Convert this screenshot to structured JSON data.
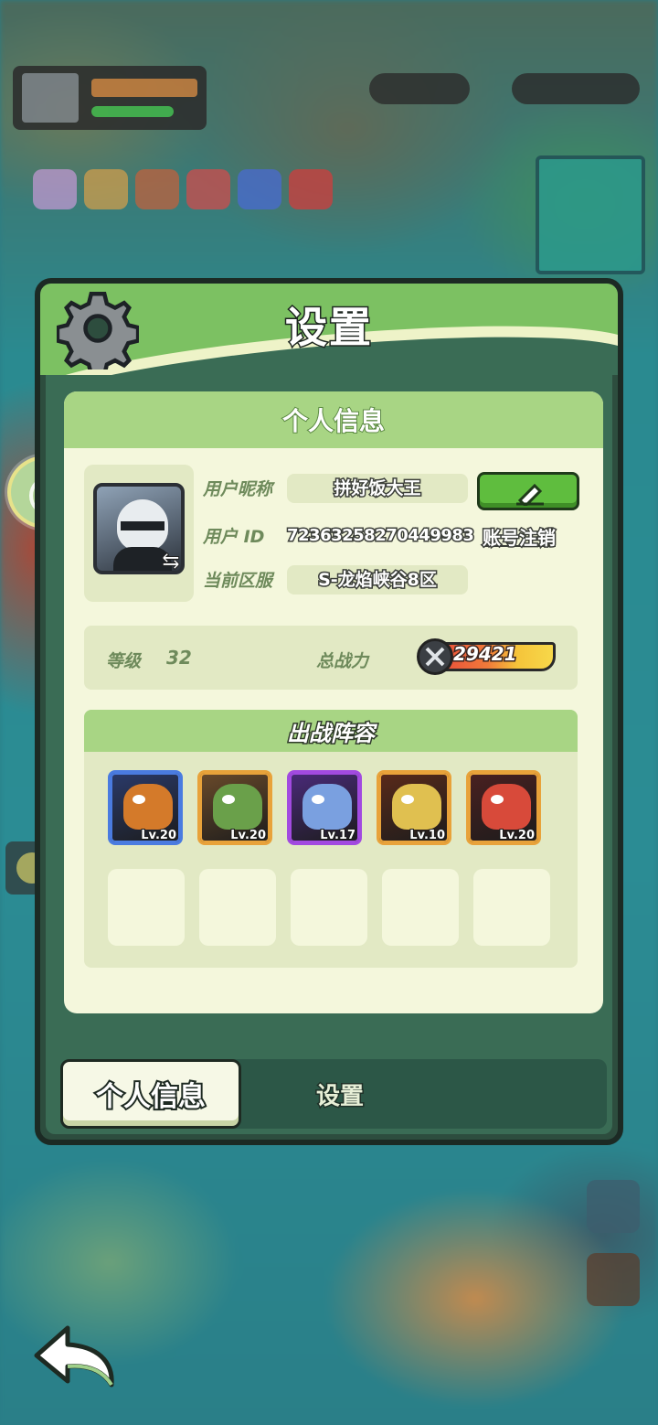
{
  "colors": {
    "header_green": "#7cc162",
    "card_bg": "#f4f7dc",
    "section_green": "#a8d584",
    "panel_dark": "#2d4d3e",
    "edit_green": "#5fbd3e"
  },
  "panel": {
    "title": "设置",
    "icon": "gear-icon"
  },
  "profile": {
    "section_title": "个人信息",
    "nickname_label": "用户昵称",
    "nickname": "拼好饭大王",
    "id_label": "用户 ID",
    "id_value": "72363258270449983",
    "server_label": "当前区服",
    "server": "S-龙焰峡谷8区",
    "deregister": "账号注销",
    "edit_icon": "pencil-icon",
    "swap_icon": "swap-arrows-icon"
  },
  "stats": {
    "level_label": "等级",
    "level": "32",
    "power_label": "总战力",
    "power": "29421"
  },
  "lineup": {
    "title": "出战阵容",
    "heroes": [
      {
        "level": "Lv.20",
        "border": "#4a7be0",
        "bg": "#2a3a6a",
        "fig": "#d47a2a"
      },
      {
        "level": "Lv.20",
        "border": "#e8a23a",
        "bg": "#6a4a2a",
        "fig": "#6aa04a"
      },
      {
        "level": "Lv.17",
        "border": "#a24ae0",
        "bg": "#4a2a7a",
        "fig": "#7aa0e0"
      },
      {
        "level": "Lv.10",
        "border": "#e8a23a",
        "bg": "#5a2a1a",
        "fig": "#e0c050"
      },
      {
        "level": "Lv.20",
        "border": "#e8a23a",
        "bg": "#4a2020",
        "fig": "#d84a3a"
      }
    ],
    "empty_slots": 5
  },
  "tabs": {
    "active": "个人信息",
    "inactive": "设置"
  },
  "nav": {
    "back_icon": "back-arrow-icon",
    "side_icon": "leaf-planet-icon"
  }
}
